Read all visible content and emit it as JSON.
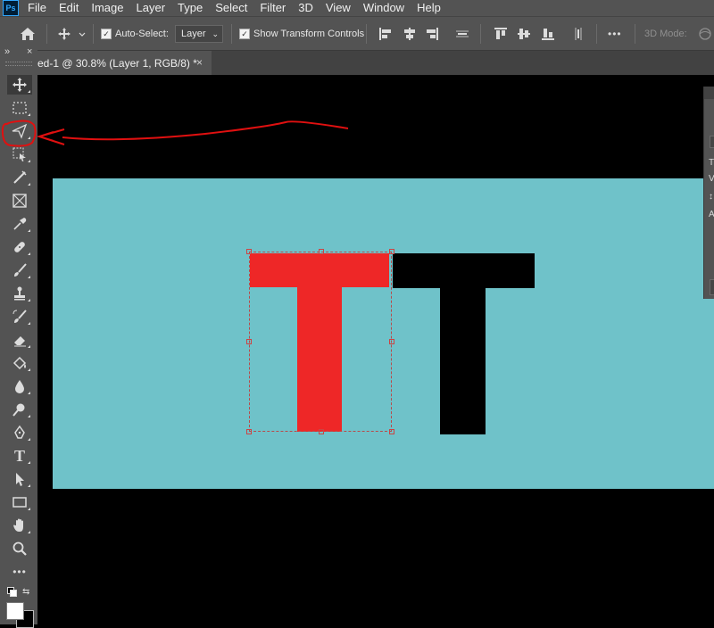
{
  "app": {
    "logo_text": "Ps"
  },
  "menubar": {
    "items": [
      "File",
      "Edit",
      "Image",
      "Layer",
      "Type",
      "Select",
      "Filter",
      "3D",
      "View",
      "Window",
      "Help"
    ]
  },
  "options_bar": {
    "auto_select_label": "Auto-Select:",
    "auto_select_checked": true,
    "target_value": "Layer",
    "show_transform_label": "Show Transform Controls",
    "show_transform_checked": true,
    "more_label": "•••",
    "mode_3d_label": "3D Mode:"
  },
  "document_tab": {
    "title": "ed-1 @ 30.8% (Layer 1, RGB/8) *",
    "close": "×"
  },
  "toolbar": {
    "collapse_glyph": "»",
    "close_glyph": "×",
    "type_tool_glyph": "T",
    "more_tools_glyph": "•••"
  },
  "canvas": {
    "artboard_color": "#6fc2c9",
    "letter_1": {
      "glyph": "T",
      "color": "#ee2727"
    },
    "letter_2": {
      "glyph": "T",
      "color": "#000000"
    }
  },
  "right_panel": {
    "partial_chars": [
      "T",
      "V",
      "↕",
      "A"
    ]
  },
  "annotation": {
    "color": "#e01010"
  }
}
